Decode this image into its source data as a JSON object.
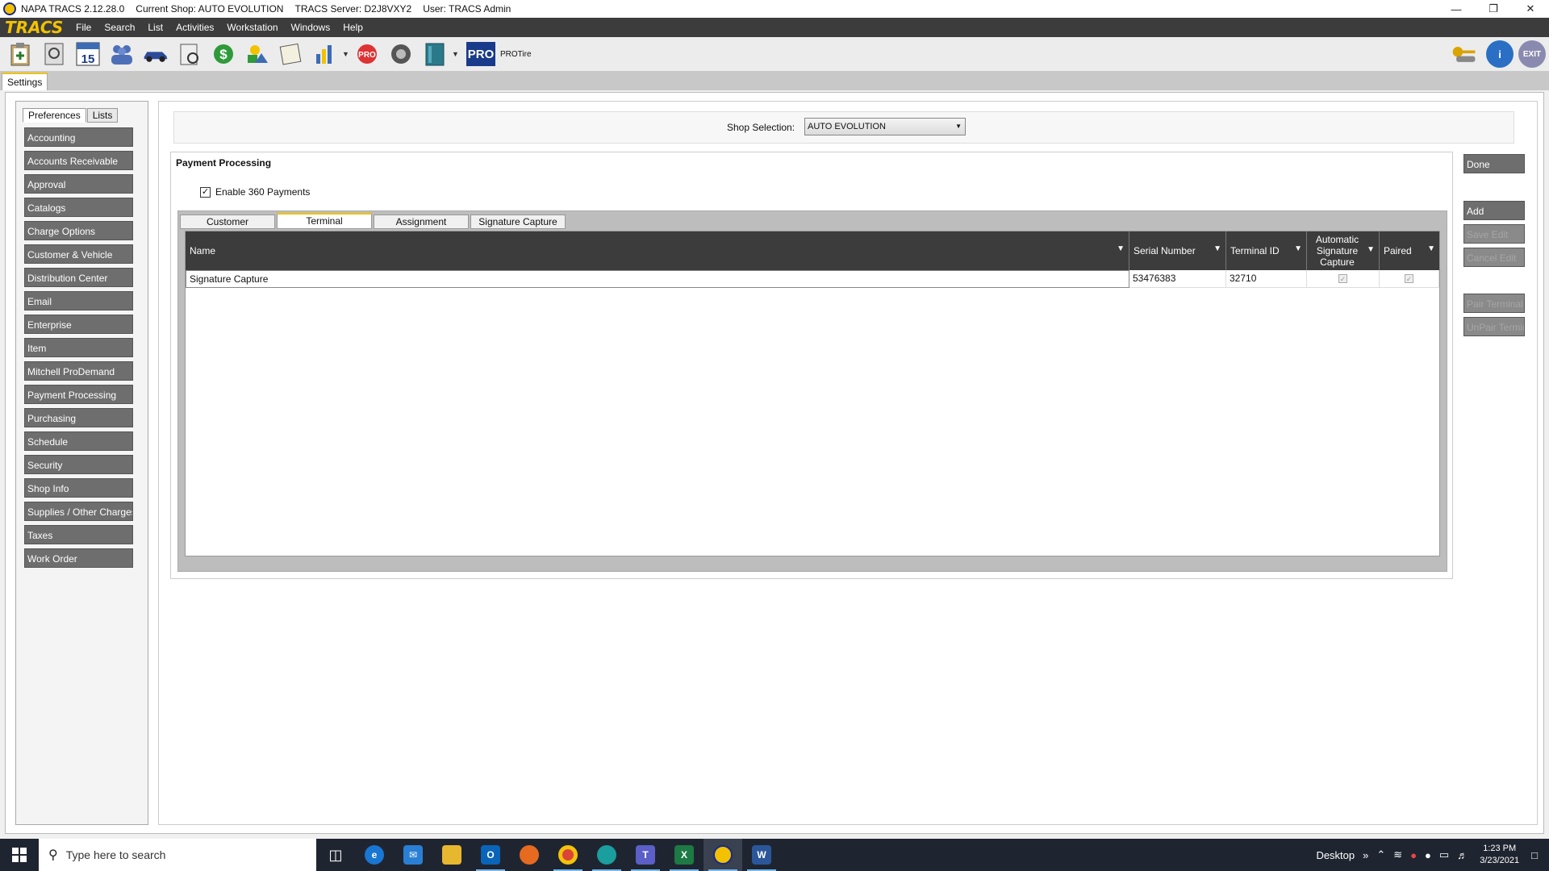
{
  "titlebar": {
    "app": "NAPA TRACS 2.12.28.0",
    "shop": "Current Shop: AUTO EVOLUTION",
    "server": "TRACS Server: D2J8VXY2",
    "user": "User: TRACS Admin"
  },
  "menubar": {
    "brand": "TRACS",
    "items": [
      "File",
      "Search",
      "List",
      "Activities",
      "Workstation",
      "Windows",
      "Help"
    ]
  },
  "toolbar": {
    "pro": "PRO",
    "protire": "PROTire",
    "calendar_day": "15",
    "exit": "EXIT"
  },
  "tab": {
    "settings": "Settings"
  },
  "leftpanel": {
    "tabs": [
      "Preferences",
      "Lists"
    ],
    "items": [
      "Accounting",
      "Accounts Receivable",
      "Approval",
      "Catalogs",
      "Charge Options",
      "Customer & Vehicle",
      "Distribution Center",
      "Email",
      "Enterprise",
      "Item",
      "Mitchell ProDemand",
      "Payment Processing",
      "Purchasing",
      "Schedule",
      "Security",
      "Shop Info",
      "Supplies / Other Charges",
      "Taxes",
      "Work Order"
    ]
  },
  "shop": {
    "label": "Shop Selection:",
    "value": "AUTO EVOLUTION"
  },
  "payment": {
    "title": "Payment Processing",
    "enable_label": "Enable 360 Payments",
    "tabs": [
      "Customer",
      "Terminal",
      "Assignment",
      "Signature Capture"
    ],
    "columns": [
      "Name",
      "Serial Number",
      "Terminal ID",
      "Automatic Signature Capture",
      "Paired"
    ],
    "rows": [
      {
        "name": "Signature Capture",
        "serial": "53476383",
        "terminal_id": "32710"
      }
    ]
  },
  "buttons": {
    "done": "Done",
    "add": "Add",
    "save_edit": "Save Edit",
    "cancel_edit": "Cancel Edit",
    "pair_terminal": "Pair Terminal",
    "unpair_terminal": "UnPair Terminal"
  },
  "taskbar": {
    "search_placeholder": "Type here to search",
    "desktop": "Desktop",
    "time": "1:23 PM",
    "date": "3/23/2021"
  }
}
